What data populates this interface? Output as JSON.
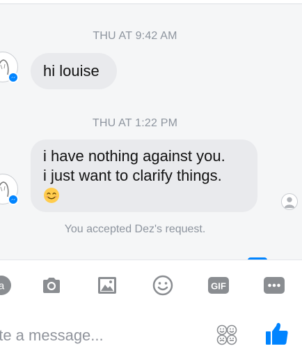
{
  "conversation": {
    "messages": [
      {
        "timestamp": "THU AT 9:42 AM",
        "text": "hi louise"
      },
      {
        "timestamp": "THU AT 1:22 PM",
        "lines": [
          "i have nothing against you.",
          "i just want to clarify things."
        ],
        "emoji": "smiling-face-emoji"
      }
    ],
    "system_note": "You accepted Dez's request."
  },
  "composer": {
    "placeholder": "rite a message..."
  },
  "toolbar": {
    "gif_label": "GIF",
    "a_label": "a"
  },
  "icons": {
    "camera": "camera-icon",
    "image": "image-icon",
    "emoji": "emoji-icon",
    "gif": "gif-icon",
    "more": "more-icon",
    "stickers": "sticker-icon",
    "like": "thumbs-up-icon",
    "messenger_badge": "messenger-badge-icon"
  },
  "colors": {
    "accent": "#0084ff",
    "bubble": "#e9eaed",
    "muted_text": "#8d949e",
    "icon_gray": "#8a8d91"
  }
}
